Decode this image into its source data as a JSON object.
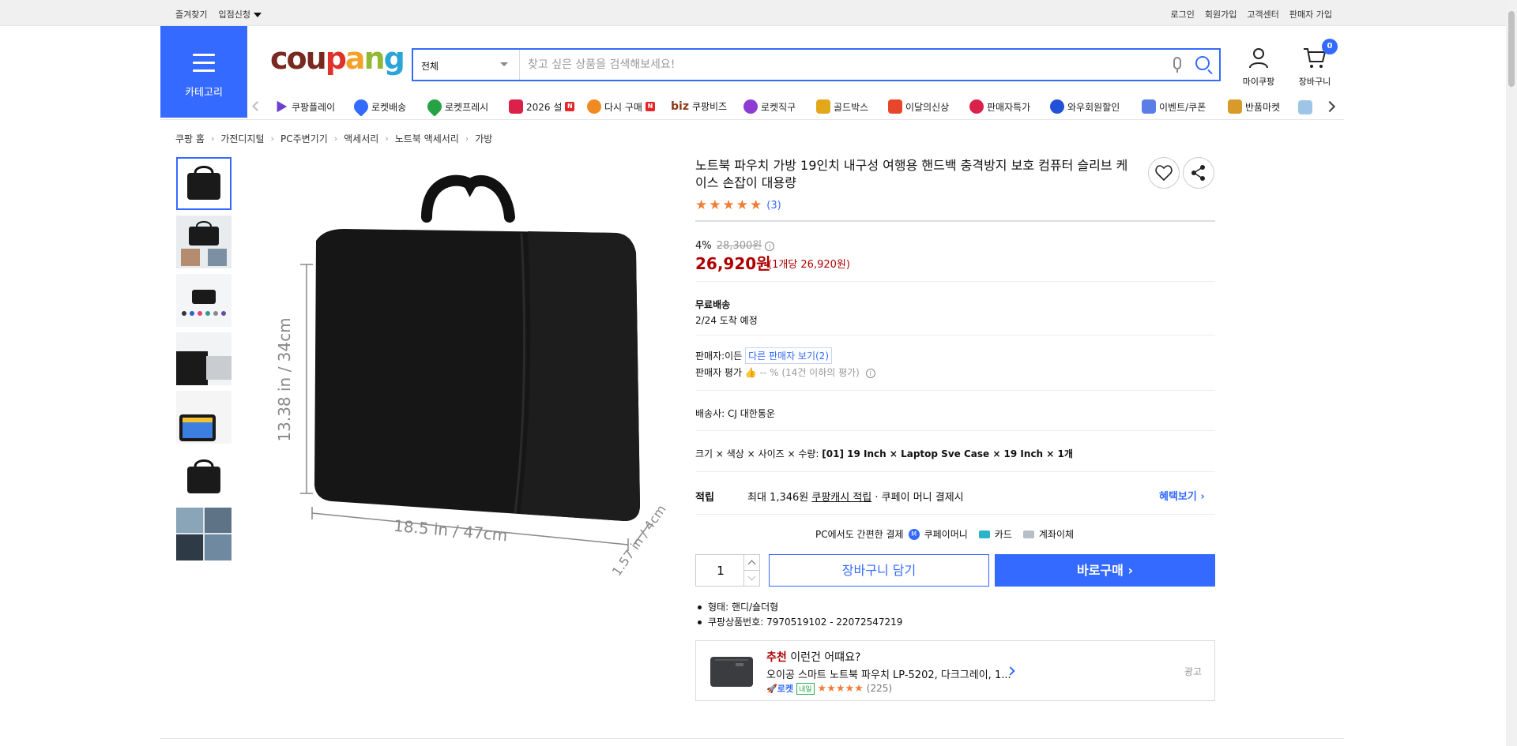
{
  "topbar": {
    "left": [
      "즐겨찾기",
      "입점신청"
    ],
    "right": [
      "로그인",
      "회원가입",
      "고객센터",
      "판매자 가입"
    ]
  },
  "header": {
    "category_label": "카테고리",
    "logo": {
      "c1": "c",
      "o": "o",
      "u": "u",
      "p": "p",
      "a": "a",
      "n": "n",
      "g": "g"
    },
    "search": {
      "scope": "전체",
      "placeholder": "찾고 싶은 상품을 검색해보세요!"
    },
    "my_label": "마이쿠팡",
    "cart_label": "장바구니",
    "cart_count": "0"
  },
  "nav": [
    {
      "label": "쿠팡플레이",
      "icon": "play-icon",
      "color": "#6b3fd4"
    },
    {
      "label": "로켓배송",
      "icon": "rocket-icon",
      "color": "#346aff"
    },
    {
      "label": "로켓프레시",
      "icon": "rocket-fresh-icon",
      "color": "#25a244"
    },
    {
      "label": "2026 설",
      "icon": "gift-icon",
      "color": "#d9214a",
      "badge": "N"
    },
    {
      "label": "다시 구매",
      "icon": "rebuy-icon",
      "color": "#f08a22",
      "badge": "N"
    },
    {
      "label": "쿠팡비즈",
      "prefix": "biz",
      "icon": "biz-icon",
      "color": "#8a3a1a"
    },
    {
      "label": "로켓직구",
      "icon": "global-icon",
      "color": "#8e3ad4"
    },
    {
      "label": "골드박스",
      "icon": "goldbox-icon",
      "color": "#e3a81a"
    },
    {
      "label": "이달의신상",
      "icon": "new-icon",
      "color": "#e8462a"
    },
    {
      "label": "판매자특가",
      "icon": "sale-icon",
      "color": "#d9214a"
    },
    {
      "label": "와우회원할인",
      "icon": "wow-icon",
      "color": "#2250d6"
    },
    {
      "label": "이벤트/쿠폰",
      "icon": "coupon-icon",
      "color": "#5a7de8"
    },
    {
      "label": "반품마켓",
      "icon": "market-icon",
      "color": "#d89a2a"
    }
  ],
  "breadcrumb": [
    "쿠팡 홈",
    "가전디지털",
    "PC주변기기",
    "액세서리",
    "노트북 액세서리",
    "가방"
  ],
  "product": {
    "title": "노트북 파우치 가방 19인치 내구성 여행용 핸드백 충격방지 보호 컴퓨터 슬리브 케이스 손잡이 대용량",
    "rating": 5,
    "review_count": "(3)",
    "discount": "4%",
    "original_price": "28,300원",
    "price": "26,920원",
    "unit_price": "(1개당 26,920원)",
    "shipping_title": "무료배송",
    "arrival": "2/24 도착 예정",
    "seller_label": "판매자:",
    "seller_name": "이든",
    "other_sellers": "다른 판매자 보기(2)",
    "seller_rating_label": "판매자 평가",
    "seller_rating_value": "-- %",
    "seller_rating_note": "(14건 이하의 평가)",
    "carrier_label": "배송사:",
    "carrier": "CJ 대한통운",
    "option_label": "크기 × 색상 × 사이즈 × 수량:",
    "option_value": "[01] 19 Inch × Laptop Sve Case × 19 Inch × 1개",
    "reward_label": "적립",
    "reward_text_1": "최대 1,346원",
    "reward_link": "쿠팡캐시 적립",
    "reward_text_2": "· 쿠페이 머니 결제시",
    "benefit_link": "혜택보기",
    "pc_pay_label": "PC에서도 간편한 결제",
    "pay_methods": [
      "쿠페이머니",
      "카드",
      "계좌이체"
    ],
    "quantity": "1",
    "add_cart": "장바구니 담기",
    "buy_now": "바로구매",
    "bullets": [
      "형태: 핸디/숄더형",
      "쿠팡상품번호: 7970519102 - 22072547219"
    ],
    "image_labels": {
      "height": "13.38 in / 34cm",
      "width": "18.5 in / 47cm",
      "depth": "1.57 in / 4cm"
    }
  },
  "recommend": {
    "highlight": "추천",
    "title": "이런건 어떄요?",
    "name": "오이공 스마트 노트북 파우치 LP-5202, 다크그레이, 1...",
    "rocket": "로켓",
    "rocket_tag": "내일",
    "rating": 5,
    "review_count": "(225)",
    "ad": "광고"
  },
  "colors": {
    "accent": "#346aff",
    "price": "#ae0000",
    "star": "#f27d36"
  }
}
